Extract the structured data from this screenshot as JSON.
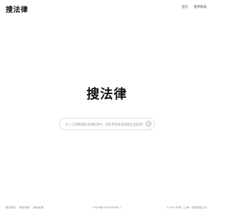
{
  "header": {
    "logo": "搜法律",
    "nav": [
      {
        "label": "首页"
      },
      {
        "label": "使用帮助"
      }
    ]
  },
  "hero": {
    "title": "搜法律"
  },
  "search": {
    "placeholder": "在人工智能辅助法律检索中，如何界定知道或者应当知道？",
    "value": ""
  },
  "footer": {
    "links": [
      {
        "label": "联系我们"
      },
      {
        "label": "服务条款"
      },
      {
        "label": "隐私政策"
      }
    ],
    "icp": "沪ICP备2024073403号-1",
    "copyright": "© 2024 华鼎（上海）信息有限公司"
  },
  "colors": {
    "background": "#ffffff",
    "text": "#111111",
    "muted": "#8a8a90",
    "send_button": "#d9d9de"
  },
  "icons": {
    "send": "arrow-up-icon"
  }
}
